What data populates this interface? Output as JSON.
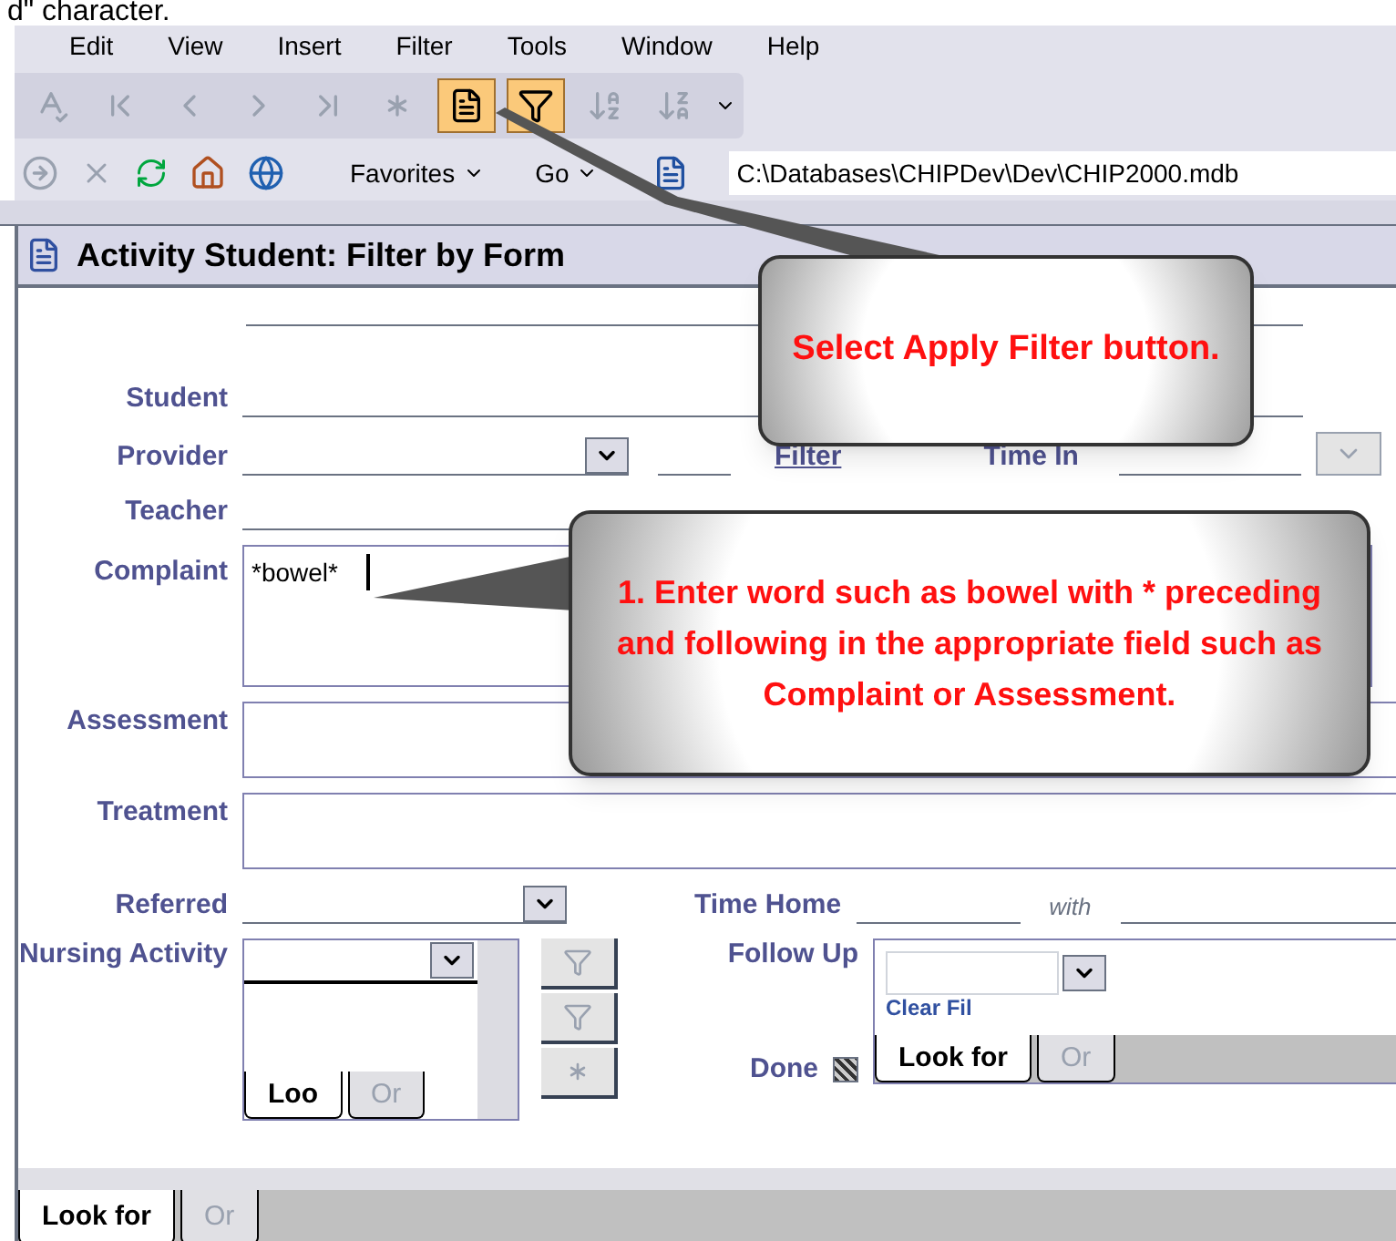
{
  "caption_fragment": "d\" character.",
  "menu": [
    "Edit",
    "View",
    "Insert",
    "Filter",
    "Tools",
    "Window",
    "Help"
  ],
  "toolbar": [
    {
      "kind": "spelling",
      "disabled": true,
      "highlighted": false
    },
    {
      "kind": "first",
      "disabled": true,
      "highlighted": false
    },
    {
      "kind": "previous",
      "disabled": true,
      "highlighted": false
    },
    {
      "kind": "next",
      "disabled": true,
      "highlighted": false
    },
    {
      "kind": "last",
      "disabled": true,
      "highlighted": false
    },
    {
      "kind": "new",
      "disabled": true,
      "highlighted": false
    },
    {
      "kind": "filter_form",
      "disabled": false,
      "highlighted": true
    },
    {
      "kind": "apply_filter",
      "disabled": false,
      "highlighted": true
    },
    {
      "kind": "sort_asc",
      "disabled": true,
      "highlighted": false
    },
    {
      "kind": "sort_desc",
      "disabled": true,
      "highlighted": false
    }
  ],
  "web_toolbar": {
    "favorites": "Favorites",
    "go": "Go",
    "address": "C:\\Databases\\CHIPDev\\Dev\\CHIP2000.mdb"
  },
  "form": {
    "title": "Activity Student: Filter by Form",
    "student": {
      "label": "Student"
    },
    "provider": {
      "label": "Provider",
      "link": "Filter",
      "time_in_label": "Time In"
    },
    "teacher": {
      "label": "Teacher"
    },
    "complaint": {
      "label": "Complaint",
      "value": "*bowel*"
    },
    "assessment": {
      "label": "Assessment"
    },
    "treatment": {
      "label": "Treatment"
    },
    "referred": {
      "label": "Referred",
      "time_home_label": "Time Home",
      "with_label": "with"
    },
    "nursing_activity": {
      "label": "Nursing Activity",
      "tabs": [
        {
          "label": "Loo",
          "selected": true
        },
        {
          "label": "Or",
          "selected": false
        }
      ]
    },
    "follow_up": {
      "label": "Follow Up",
      "partial_text": "Clear Fil",
      "tabs": [
        {
          "label": "Look for",
          "selected": true
        },
        {
          "label": "Or",
          "selected": false
        }
      ]
    },
    "done": {
      "label": "Done",
      "indeterminate": true
    },
    "tabs": [
      {
        "label": "Look for",
        "selected": true
      },
      {
        "label": "Or",
        "selected": false
      }
    ]
  },
  "callouts": [
    {
      "text": "Select Apply Filter button."
    },
    {
      "text": "1. Enter word such as bowel with * preceding and following in the appropriate field such as Complaint or Assessment."
    }
  ]
}
